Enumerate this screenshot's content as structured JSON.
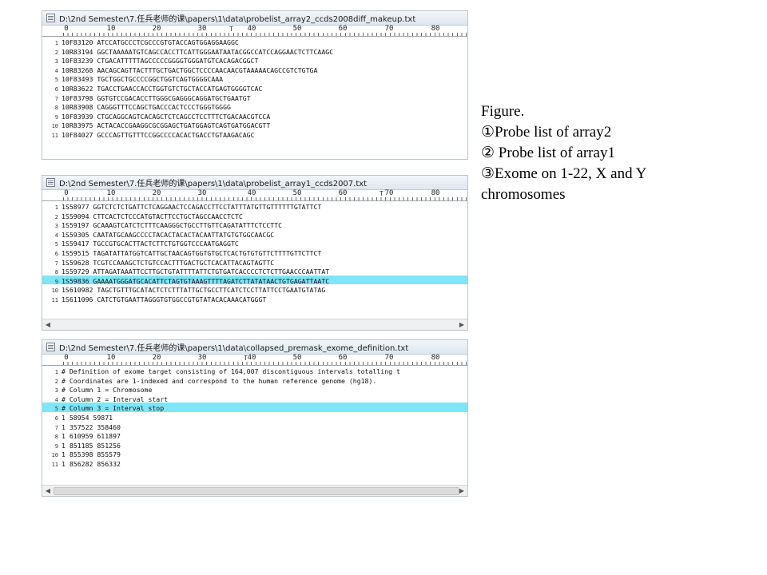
{
  "windows": [
    {
      "title": "D:\\2nd Semester\\7.任兵老师的课\\papers\\1\\data\\probelist_array2_ccds2008diff_makeup.txt",
      "ruler": [
        "0",
        "10",
        "20",
        "30",
        "40",
        "50",
        "60",
        "70",
        "80"
      ],
      "lines": [
        {
          "num": "1",
          "text": "10F83120  ATCCATGCCCTCGCCCGTGTACCAGTGGAGGAAGGC"
        },
        {
          "num": "2",
          "text": "10R83194  GGCTAAAAATGTCAGCCACCTTCATTGGGAATAATACGGCCATCCAGGAACTCTTCAAGC"
        },
        {
          "num": "3",
          "text": "10F83239  CTGACATTTTTAGCCCCCGGGGTGGGATGTCACAGACGGCT"
        },
        {
          "num": "4",
          "text": "10R83268  AACAGCAGTTACTTTGCTGACTGGCTCCCCAACAACGTAAAAACAGCCGTCTGTGA"
        },
        {
          "num": "5",
          "text": "10F83493  TGCTGGCTGCCCCGGCTGGTCAGTGGGGCAAA"
        },
        {
          "num": "6",
          "text": "10R83622  TGACCTGAACCACCTGGTGTCTGCTACCATGAGTGGGGTCAC"
        },
        {
          "num": "7",
          "text": "10F83798  GGTGTCCGACACCTTGGGCGAGGGCAGGATGCTGAATGT"
        },
        {
          "num": "8",
          "text": "10R83908  CAGGGTTTCCAGCTGACCCACTCCCTGGGTGGGG"
        },
        {
          "num": "9",
          "text": "10F83939  CTGCAGGCAGTCACAGCTCTCAGCCTCCTTTCTGACAACGTCCA"
        },
        {
          "num": "10",
          "text": "10R83975  ACTACACCGAAGGCGCGGAGCTGATGGAGTCAGTGATGGACGTT"
        },
        {
          "num": "11",
          "text": "10F84027  GCCCAGTTGTTTCCGGCCCCACACTGACCTGTAAGACAGC"
        }
      ]
    },
    {
      "title": "D:\\2nd Semester\\7.任兵老师的课\\papers\\1\\data\\probelist_array1_ccds2007.txt",
      "ruler": [
        "0",
        "10",
        "20",
        "30",
        "40",
        "50",
        "60",
        "70",
        "80"
      ],
      "lines": [
        {
          "num": "1",
          "text": "1S58977  GGTCTCTCTGATTCTCAGGAACTCCAGACCTTCCTATTTATGTTGTTTTTTGTATTCT"
        },
        {
          "num": "2",
          "text": "1S59094  CTTCACTCTCCCATGTACTTCCTGCTAGCCAACCTCTC"
        },
        {
          "num": "3",
          "text": "1S59197  GCAAAGTCATCTCTTTCAAGGGCTGCCTTGTTCAGATATTTCTCCTTC"
        },
        {
          "num": "4",
          "text": "1S59305  CAATATGCAAGCCCCTACACTACACTACAATTATGTGTGGCAACGC"
        },
        {
          "num": "5",
          "text": "1S59417  TGCCGTGCACTTACTCTTCTGTGGTCCCAATGAGGTC"
        },
        {
          "num": "6",
          "text": "1S59515  TAGATATTATGGTCATTGCTAACAGTGGTGTGCTCACTGTGTGTTCTTTTGTTCTTCT"
        },
        {
          "num": "7",
          "text": "1S59628  TCGTCCAAAGCTCTGTCCACTTTGACTGCTCACATTACAGTAGTTC"
        },
        {
          "num": "8",
          "text": "1S59729  ATTAGATAAATTCCTTGCTGTATTTTATTCTGTGATCACCCCTCTCTTGAACCCAATTAT"
        },
        {
          "num": "9",
          "text": "1S59836  GAAAATGGGATGCACATTCTAGTGTAAAGTTTTAGATCTTATATAACTGTGAGATTAATC",
          "highlight": true
        },
        {
          "num": "10",
          "text": "1S610982  TAGCTGTTTGCATACTCTCTTTATTGCTGCCTTCATCTCCTTATTCCTGAATGTATAG"
        },
        {
          "num": "11",
          "text": "1S611096  CATCTGTGAATTAGGGTGTGGCCGTGTATACACAAACATGGGT"
        }
      ]
    },
    {
      "title": "D:\\2nd Semester\\7.任兵老师的课\\papers\\1\\data\\collapsed_premask_exome_definition.txt",
      "ruler": [
        "0",
        "10",
        "20",
        "30",
        "40",
        "50",
        "60",
        "70",
        "80"
      ],
      "lines": [
        {
          "num": "1",
          "text": "# Definition of exome target consisting of 164,007 discontiguous intervals totalling t"
        },
        {
          "num": "2",
          "text": "# Coordinates are 1-indexed and correspond to the human reference genome (hg18)."
        },
        {
          "num": "3",
          "text": "# Column 1 = Chromosome"
        },
        {
          "num": "4",
          "text": "# Column 2 = Interval start"
        },
        {
          "num": "5",
          "text": "# Column 3 = Interval stop",
          "highlight": true
        },
        {
          "num": "6",
          "text": "1 58954 59871"
        },
        {
          "num": "7",
          "text": "1  357522  358460"
        },
        {
          "num": "8",
          "text": "1  610959  611897"
        },
        {
          "num": "9",
          "text": "1  851185  851256"
        },
        {
          "num": "10",
          "text": "1  855398  855579"
        },
        {
          "num": "11",
          "text": "1  856282  856332"
        }
      ]
    }
  ],
  "caption": {
    "lines": [
      "Figure.",
      "①Probe list of array2",
      "② Probe list of array1",
      "③Exome on 1-22, X and Y",
      "chromosomes"
    ]
  },
  "colors": {
    "highlight": "#7ee6f7",
    "window_border": "#b9c3cf"
  }
}
